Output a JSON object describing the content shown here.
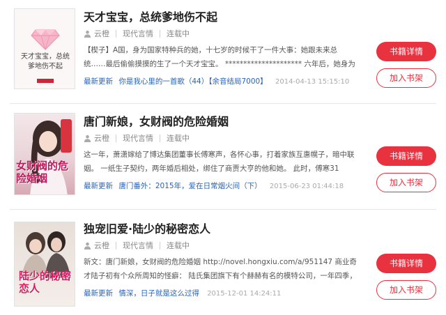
{
  "books": [
    {
      "title": "天才宝宝，总统爹地伤不起",
      "author": "云橙",
      "category": "现代言情",
      "status": "连载中",
      "description": "【楔子】A国，身为国家特种兵的她，十七岁的时候干了一件大事：她跟未来总统……最后偷偷摸摸的生了一个天才宝宝。 ********************* 六年后，她身为国家特种兵",
      "latest_label": "最新更新",
      "latest_chapter": "你是我心里的一首歌（44）【余音结局7000】",
      "update_time": "2014-04-13 15:15:10",
      "cover_text": "天才宝宝，总统爹地伤不起",
      "detail_button": "书籍详情",
      "shelf_button": "加入书架"
    },
    {
      "title": "唐门新娘，女财阀的危险婚姻",
      "author": "云橙",
      "category": "现代言情",
      "status": "连载中",
      "description": "这一年，萧潇嫁给了博达集团董事长傅寒声，各怀心事，打着家族互惠幌子，暗中联姻。 一纸生子契约，两年婚后相处，绑住了商贾大亨的他和她。 此时，傅寒31",
      "latest_label": "最新更新",
      "latest_chapter": "唐门番外：2015年，爱在日常烟火间（下）",
      "update_time": "2015-06-23 01:44:18",
      "cover_text": "女财阀的危险婚姻",
      "detail_button": "书籍详情",
      "shelf_button": "加入书架"
    },
    {
      "title": "独宠旧爱·陆少的秘密恋人",
      "author": "云橙",
      "category": "现代言情",
      "status": "连载中",
      "description": "新文：唐门新娘，女财阀的危险婚姻 http://novel.hongxiu.com/a/951147 商业奇才陆子初有个众所周知的怪癖： 陆氏集团旗下有个赫赫有名的模特公司，一年四季，每隔三",
      "latest_label": "最新更新",
      "latest_chapter": "情深，日子就是这么过得",
      "update_time": "2015-12-01 14:24:11",
      "cover_text": "陆少的秘密恋人",
      "detail_button": "书籍详情",
      "shelf_button": "加入书架"
    }
  ]
}
